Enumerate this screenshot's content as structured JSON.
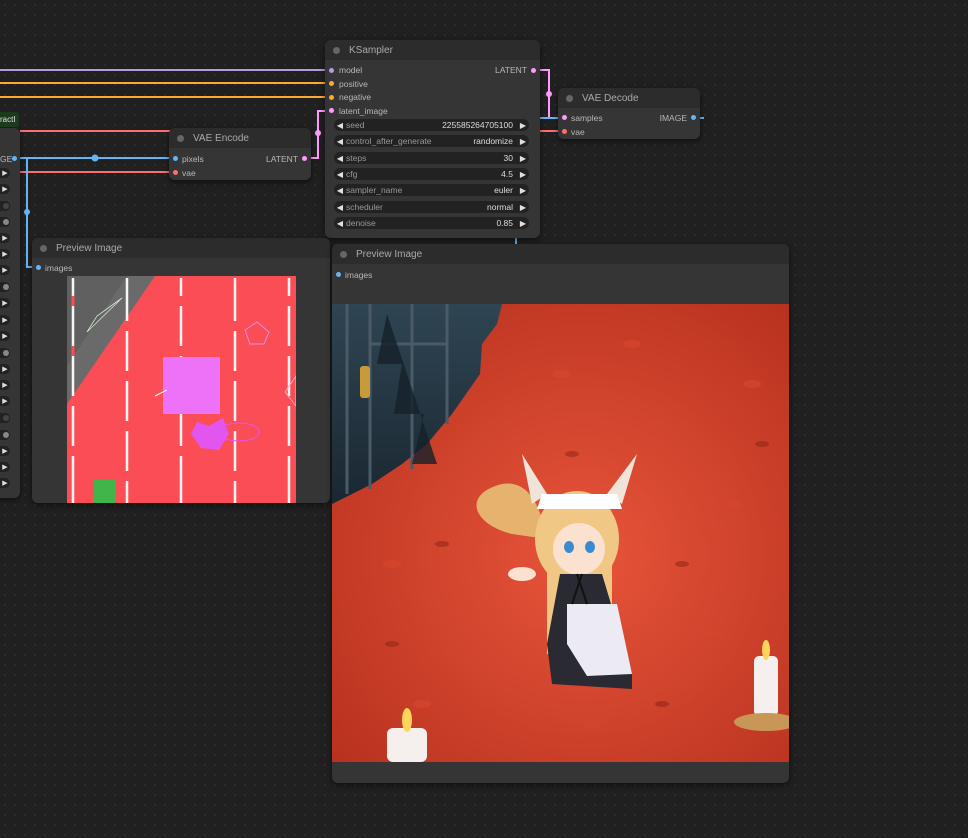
{
  "colors": {
    "model": "#b39ddb",
    "conditioning": "#ffa931",
    "latent": "#ff9cf9",
    "vae": "#ff6e6e",
    "image": "#64b5f6"
  },
  "left_partial": {
    "label_text": "ractI",
    "output_label": "GE"
  },
  "ksampler": {
    "title": "KSampler",
    "inputs": [
      "model",
      "positive",
      "negative",
      "latent_image"
    ],
    "output": "LATENT",
    "widgets": [
      {
        "label": "seed",
        "value": "225585264705100"
      },
      {
        "label": "control_after_generate",
        "value": "randomize"
      },
      {
        "label": "steps",
        "value": "30"
      },
      {
        "label": "cfg",
        "value": "4.5"
      },
      {
        "label": "sampler_name",
        "value": "euler"
      },
      {
        "label": "scheduler",
        "value": "normal"
      },
      {
        "label": "denoise",
        "value": "0.85"
      }
    ]
  },
  "vae_encode": {
    "title": "VAE Encode",
    "inputs": [
      "pixels",
      "vae"
    ],
    "output": "LATENT"
  },
  "vae_decode": {
    "title": "VAE Decode",
    "inputs": [
      "samples",
      "vae"
    ],
    "output": "IMAGE"
  },
  "preview_left": {
    "title": "Preview Image",
    "input": "images"
  },
  "preview_right": {
    "title": "Preview Image",
    "input": "images"
  }
}
